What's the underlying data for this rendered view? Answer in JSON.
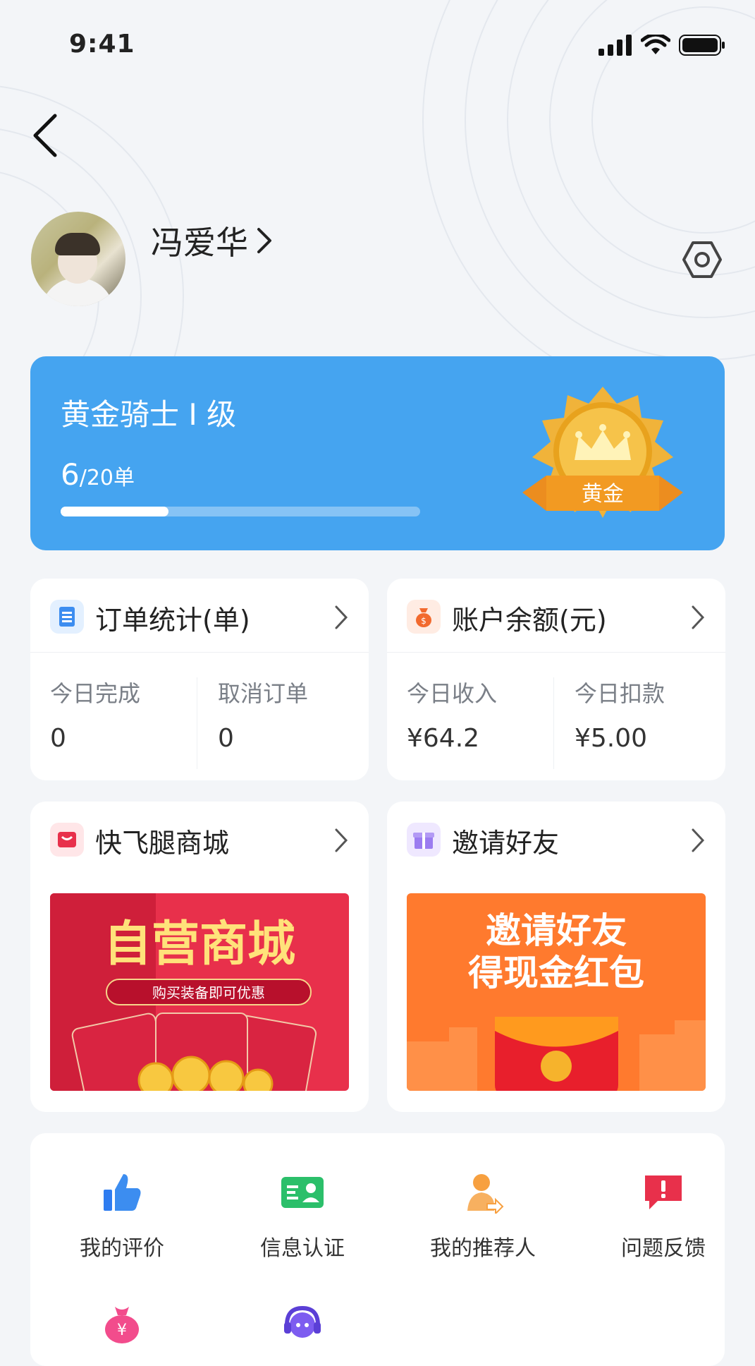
{
  "status_bar": {
    "time": "9:41"
  },
  "profile": {
    "name": "冯爱华"
  },
  "level": {
    "title": "黄金骑士 Ⅰ 级",
    "current": "6",
    "total": "/20单",
    "progress": 0.3,
    "badge_text": "黄金"
  },
  "order_stats": {
    "title": "订单统计(单)",
    "items": [
      {
        "label": "今日完成",
        "value": "0"
      },
      {
        "label": "取消订单",
        "value": "0"
      }
    ]
  },
  "balance": {
    "title": "账户余额(元)",
    "items": [
      {
        "label": "今日收入",
        "value": "¥64.2"
      },
      {
        "label": "今日扣款",
        "value": "¥5.00"
      }
    ]
  },
  "mall": {
    "title": "快飞腿商城",
    "banner_title": "自营商城",
    "banner_sub": "购买装备即可优惠"
  },
  "invite": {
    "title": "邀请好友",
    "banner_line1": "邀请好友",
    "banner_line2": "得现金红包"
  },
  "menu": {
    "items": [
      {
        "label": "我的评价"
      },
      {
        "label": "信息认证"
      },
      {
        "label": "我的推荐人"
      },
      {
        "label": "问题反馈"
      }
    ]
  },
  "colors": {
    "primary": "#45a4f0",
    "gold": "#e8a21d",
    "mall_red": "#e8304b",
    "invite_orange": "#ff7a2e"
  }
}
